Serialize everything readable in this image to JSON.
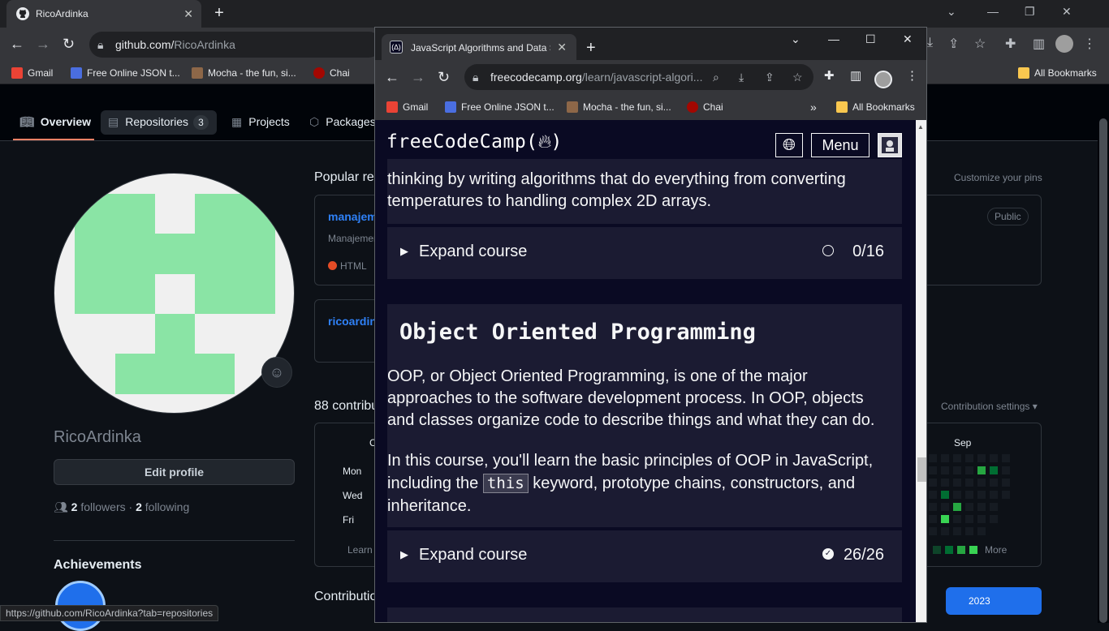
{
  "colors": {
    "gh_bg": "#0d1117",
    "fcc_bg": "#0a0a23",
    "fcc_card": "#1b1b32",
    "gh_accent": "#f78166",
    "gh_link": "#2f81f7",
    "avatar_green": "#8ae4a5",
    "avatar_bg": "#f0f0f0"
  },
  "bg_browser": {
    "tab_title": "RicoArdinka",
    "url_host": "github.com/",
    "url_path": "RicoArdinka",
    "bookmarks": [
      "Gmail",
      "Free Online JSON t...",
      "Mocha - the fun, si...",
      "Chai"
    ],
    "all_bookmarks": "All Bookmarks",
    "status_url": "https://github.com/RicoArdinka?tab=repositories"
  },
  "github": {
    "tabs": {
      "overview": "Overview",
      "repositories": "Repositories",
      "repo_count": "3",
      "projects": "Projects",
      "packages": "Packages"
    },
    "username": "RicoArdinka",
    "edit_profile": "Edit profile",
    "followers_count": "2",
    "followers_label": "followers",
    "following_count": "2",
    "following_label": "following",
    "achievements_title": "Achievements",
    "popular_title": "Popular rep",
    "pins": [
      {
        "name": "manajem",
        "desc": "Manajemen",
        "lang": "HTML"
      },
      {
        "name": "ricoardin"
      }
    ],
    "customize_pins": "Customize your pins",
    "public_badge": "Public",
    "contrib_title": "88 contribu",
    "contrib_settings": "Contribution settings ▾",
    "days": [
      "Mon",
      "Wed",
      "Fri"
    ],
    "month_label": "Sep",
    "learn_label": "Learn",
    "more_label": "More",
    "contrib_title2": "Contributio",
    "year_button": "2023"
  },
  "fg_browser": {
    "tab_title": "JavaScript Algorithms and Data S",
    "url_host": "freecodecamp.org",
    "url_path": "/learn/javascript-algori...",
    "bookmarks": [
      "Gmail",
      "Free Online JSON t...",
      "Mocha - the fun, si...",
      "Chai"
    ],
    "all_bookmarks": "All Bookmarks"
  },
  "fcc": {
    "logo": "freeCodeCamp(",
    "menu": "Menu",
    "prev_intro": "thinking by writing algorithms that do everything from converting temperatures to handling complex 2D arrays.",
    "prev_expand": "Expand course",
    "prev_progress": "0/16",
    "oop_title": "Object Oriented Programming",
    "oop_p1": "OOP, or Object Oriented Programming, is one of the major approaches to the software development process. In OOP, objects and classes organize code to describe things and what they can do.",
    "oop_p2_a": "In this course, you'll learn the basic principles of OOP in JavaScript, including the ",
    "oop_p2_code": "this",
    "oop_p2_b": " keyword, prototype chains, constructors, and inheritance.",
    "oop_expand": "Expand course",
    "oop_progress": "26/26"
  }
}
